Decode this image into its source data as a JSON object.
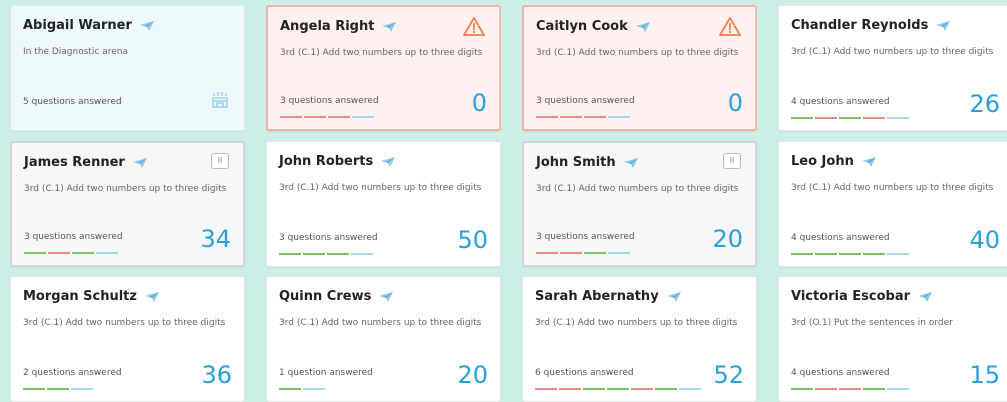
{
  "students": [
    {
      "name": "Abigail Warner",
      "status": "In the Diagnostic arena",
      "answered": "5 questions answered",
      "score": "",
      "variant": "diag",
      "icon": "arena-icon",
      "bar": []
    },
    {
      "name": "Angela Right",
      "status": "3rd (C.1) Add two numbers up to three digits",
      "answered": "3 questions answered",
      "score": "0",
      "variant": "warn",
      "icon": "warning-icon",
      "bar": [
        "r",
        "r",
        "r",
        "b"
      ]
    },
    {
      "name": "Caitlyn Cook",
      "status": "3rd (C.1) Add two numbers up to three digits",
      "answered": "3 questions answered",
      "score": "0",
      "variant": "warn",
      "icon": "warning-icon",
      "bar": [
        "r",
        "r",
        "r",
        "b"
      ]
    },
    {
      "name": "Chandler Reynolds",
      "status": "3rd (C.1) Add two numbers up to three digits",
      "answered": "4 questions answered",
      "score": "26",
      "variant": "normal",
      "icon": "",
      "bar": [
        "g",
        "r",
        "g",
        "r",
        "b"
      ]
    },
    {
      "name": "James Renner",
      "status": "3rd (C.1) Add two numbers up to three digits",
      "answered": "3 questions answered",
      "score": "34",
      "variant": "paused",
      "icon": "pause-icon",
      "bar": [
        "g",
        "r",
        "g",
        "b"
      ]
    },
    {
      "name": "John Roberts",
      "status": "3rd (C.1) Add two numbers up to three digits",
      "answered": "3 questions answered",
      "score": "50",
      "variant": "normal",
      "icon": "",
      "bar": [
        "g",
        "g",
        "g",
        "b"
      ]
    },
    {
      "name": "John Smith",
      "status": "3rd (C.1) Add two numbers up to three digits",
      "answered": "3 questions answered",
      "score": "20",
      "variant": "paused",
      "icon": "pause-icon",
      "bar": [
        "r",
        "r",
        "g",
        "b"
      ]
    },
    {
      "name": "Leo John",
      "status": "3rd (C.1) Add two numbers up to three digits",
      "answered": "4 questions answered",
      "score": "40",
      "variant": "normal",
      "icon": "",
      "bar": [
        "g",
        "g",
        "g",
        "g",
        "b"
      ]
    },
    {
      "name": "Morgan Schultz",
      "status": "3rd (C.1) Add two numbers up to three digits",
      "answered": "2 questions answered",
      "score": "36",
      "variant": "normal",
      "icon": "",
      "bar": [
        "g",
        "g",
        "b"
      ]
    },
    {
      "name": "Quinn Crews",
      "status": "3rd (C.1) Add two numbers up to three digits",
      "answered": "1 question answered",
      "score": "20",
      "variant": "normal",
      "icon": "",
      "bar": [
        "g",
        "b"
      ]
    },
    {
      "name": "Sarah Abernathy",
      "status": "3rd (C.1) Add two numbers up to three digits",
      "answered": "6 questions answered",
      "score": "52",
      "variant": "normal",
      "icon": "",
      "bar": [
        "r",
        "r",
        "g",
        "g",
        "r",
        "g",
        "b"
      ]
    },
    {
      "name": "Victoria Escobar",
      "status": "3rd (O.1) Put the sentences in order",
      "answered": "4 questions answered",
      "score": "15",
      "variant": "normal",
      "icon": "",
      "bar": [
        "g",
        "r",
        "r",
        "g",
        "b"
      ]
    }
  ],
  "pause_label": "II"
}
